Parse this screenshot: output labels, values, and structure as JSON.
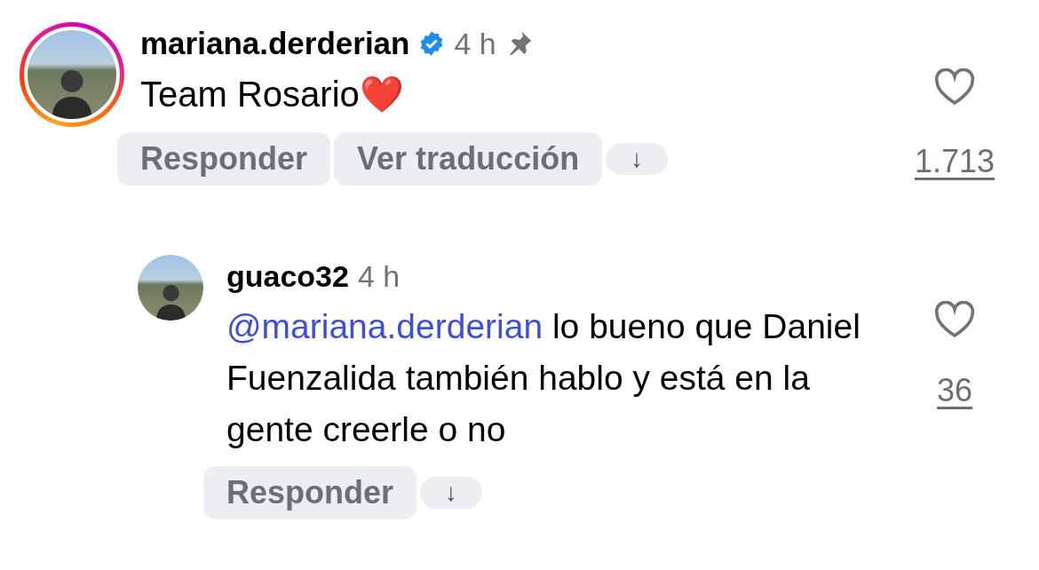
{
  "comments": [
    {
      "username": "mariana.derderian",
      "verified": true,
      "time": "4 h",
      "pinned": true,
      "story_ring": true,
      "text": [
        {
          "kind": "text",
          "text": "Team Rosario❤️"
        }
      ],
      "actions": [
        {
          "kind": "label",
          "text": "Responder"
        },
        {
          "kind": "label",
          "text": "Ver traducción"
        },
        {
          "kind": "arrow",
          "text": "↓"
        }
      ],
      "likes": "1.713",
      "replies": [
        {
          "username": "guaco32",
          "verified": false,
          "time": "4 h",
          "pinned": false,
          "story_ring": false,
          "text": [
            {
              "kind": "mention",
              "text": "@mariana.derderian"
            },
            {
              "kind": "text",
              "text": " lo bueno que Daniel Fuenzalida también hablo y está en la gente creerle o no"
            }
          ],
          "actions": [
            {
              "kind": "label",
              "text": "Responder"
            },
            {
              "kind": "arrow",
              "text": "↓"
            }
          ],
          "likes": "36"
        }
      ]
    }
  ]
}
